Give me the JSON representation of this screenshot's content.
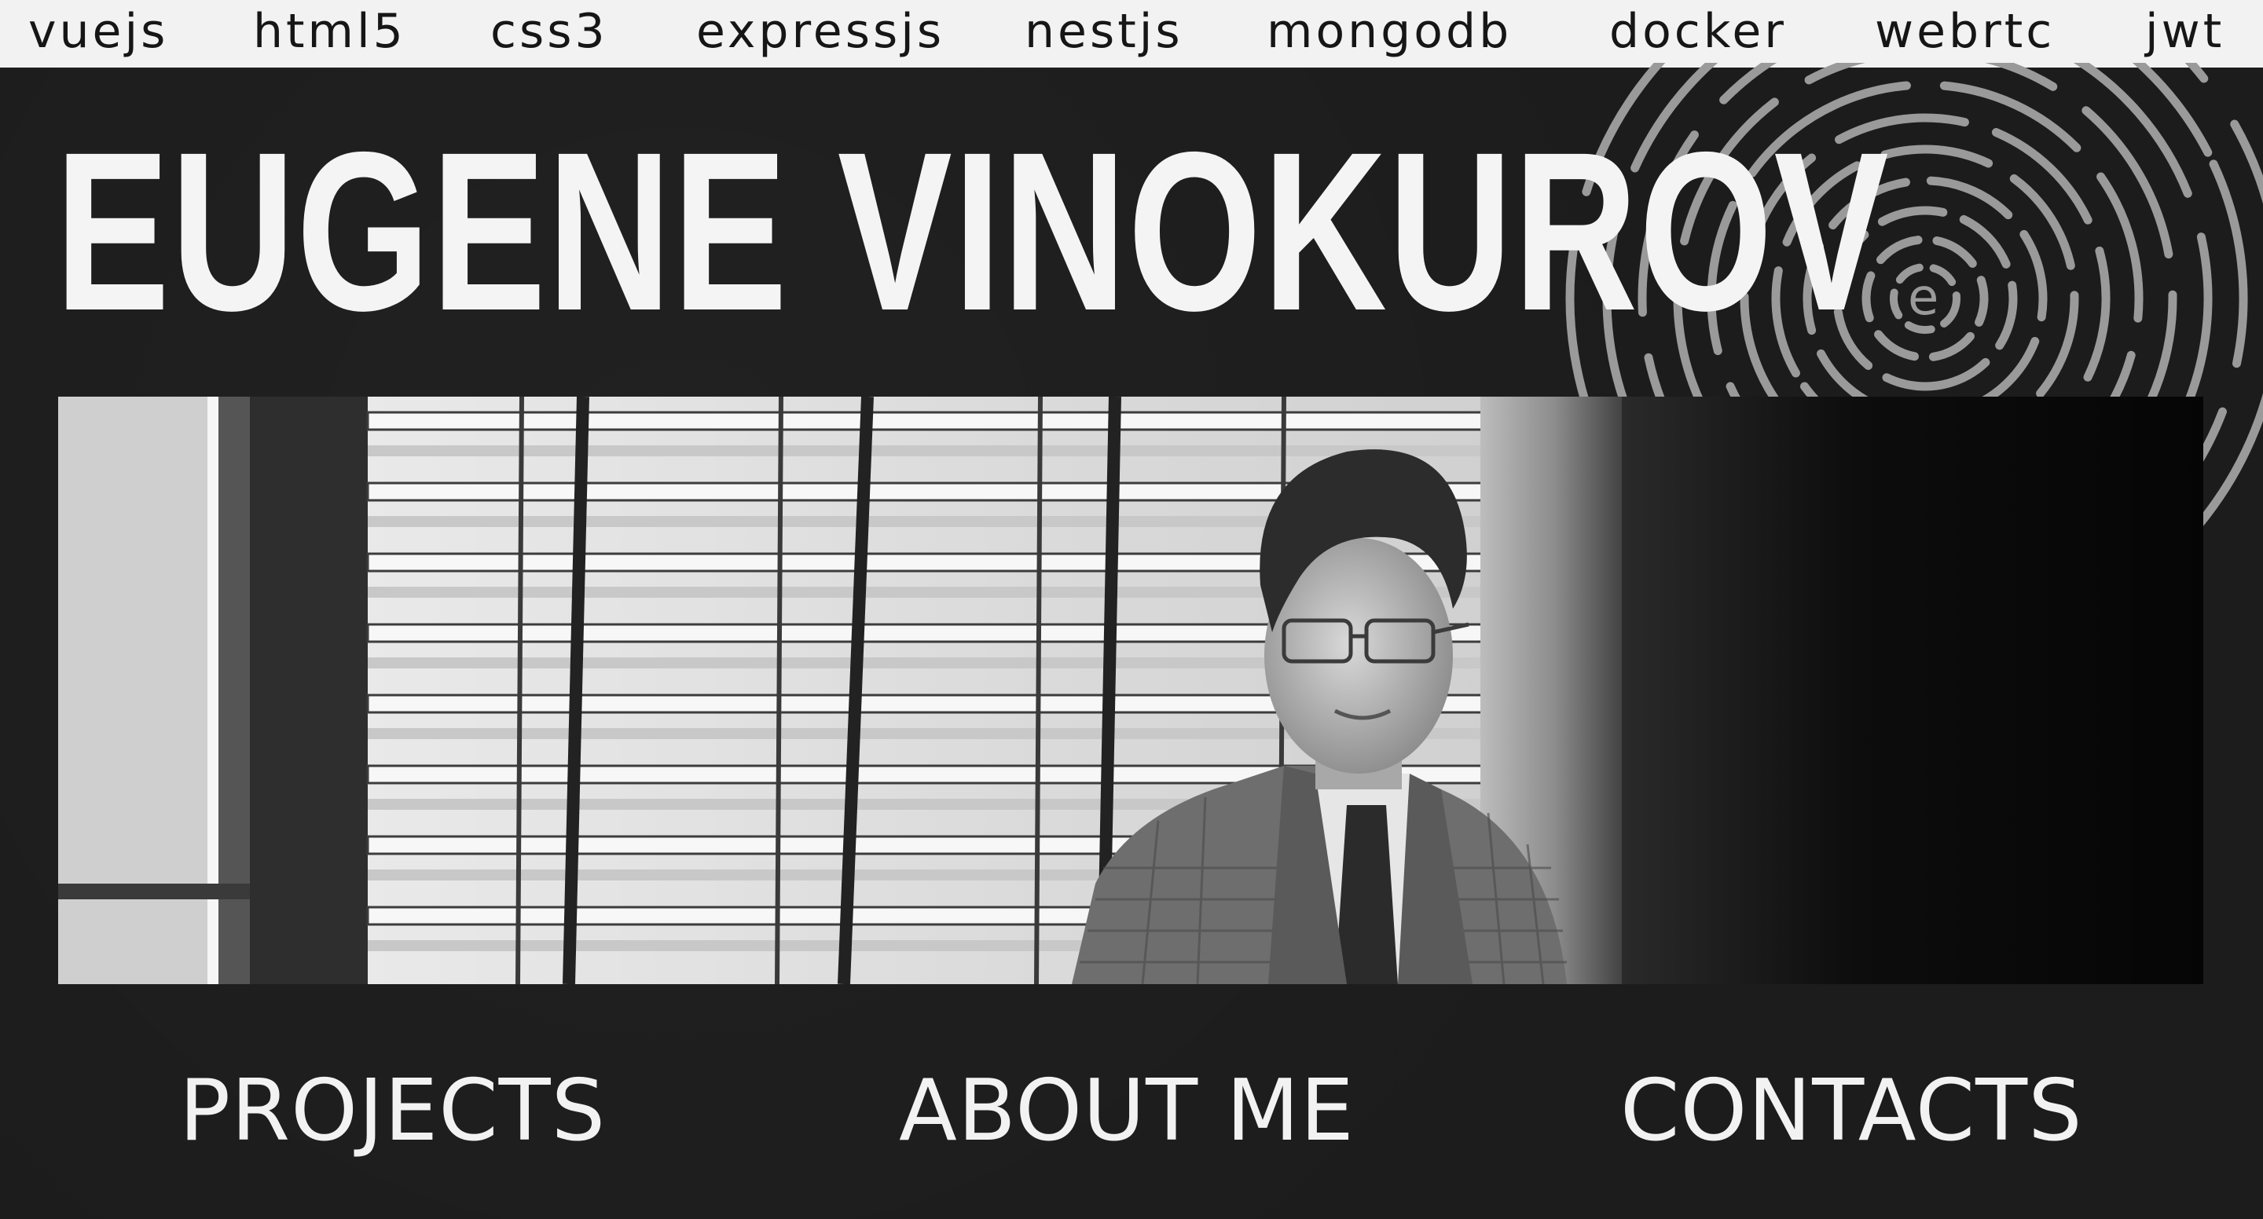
{
  "tech_stack": [
    "vuejs",
    "html5",
    "css3",
    "expressjs",
    "nestjs",
    "mongodb",
    "docker",
    "webrtc",
    "jwt"
  ],
  "hero": {
    "name": "EUGENE VINOKUROV"
  },
  "photo": {
    "icon": "portrait-photo"
  },
  "nav": {
    "projects": "PROJECTS",
    "about": "ABOUT ME",
    "contacts": "CONTACTS"
  },
  "colors": {
    "background": "#1c1c1c",
    "strip": "#f2f2f2",
    "text_light": "#f4f4f4",
    "text_dark": "#161616"
  }
}
